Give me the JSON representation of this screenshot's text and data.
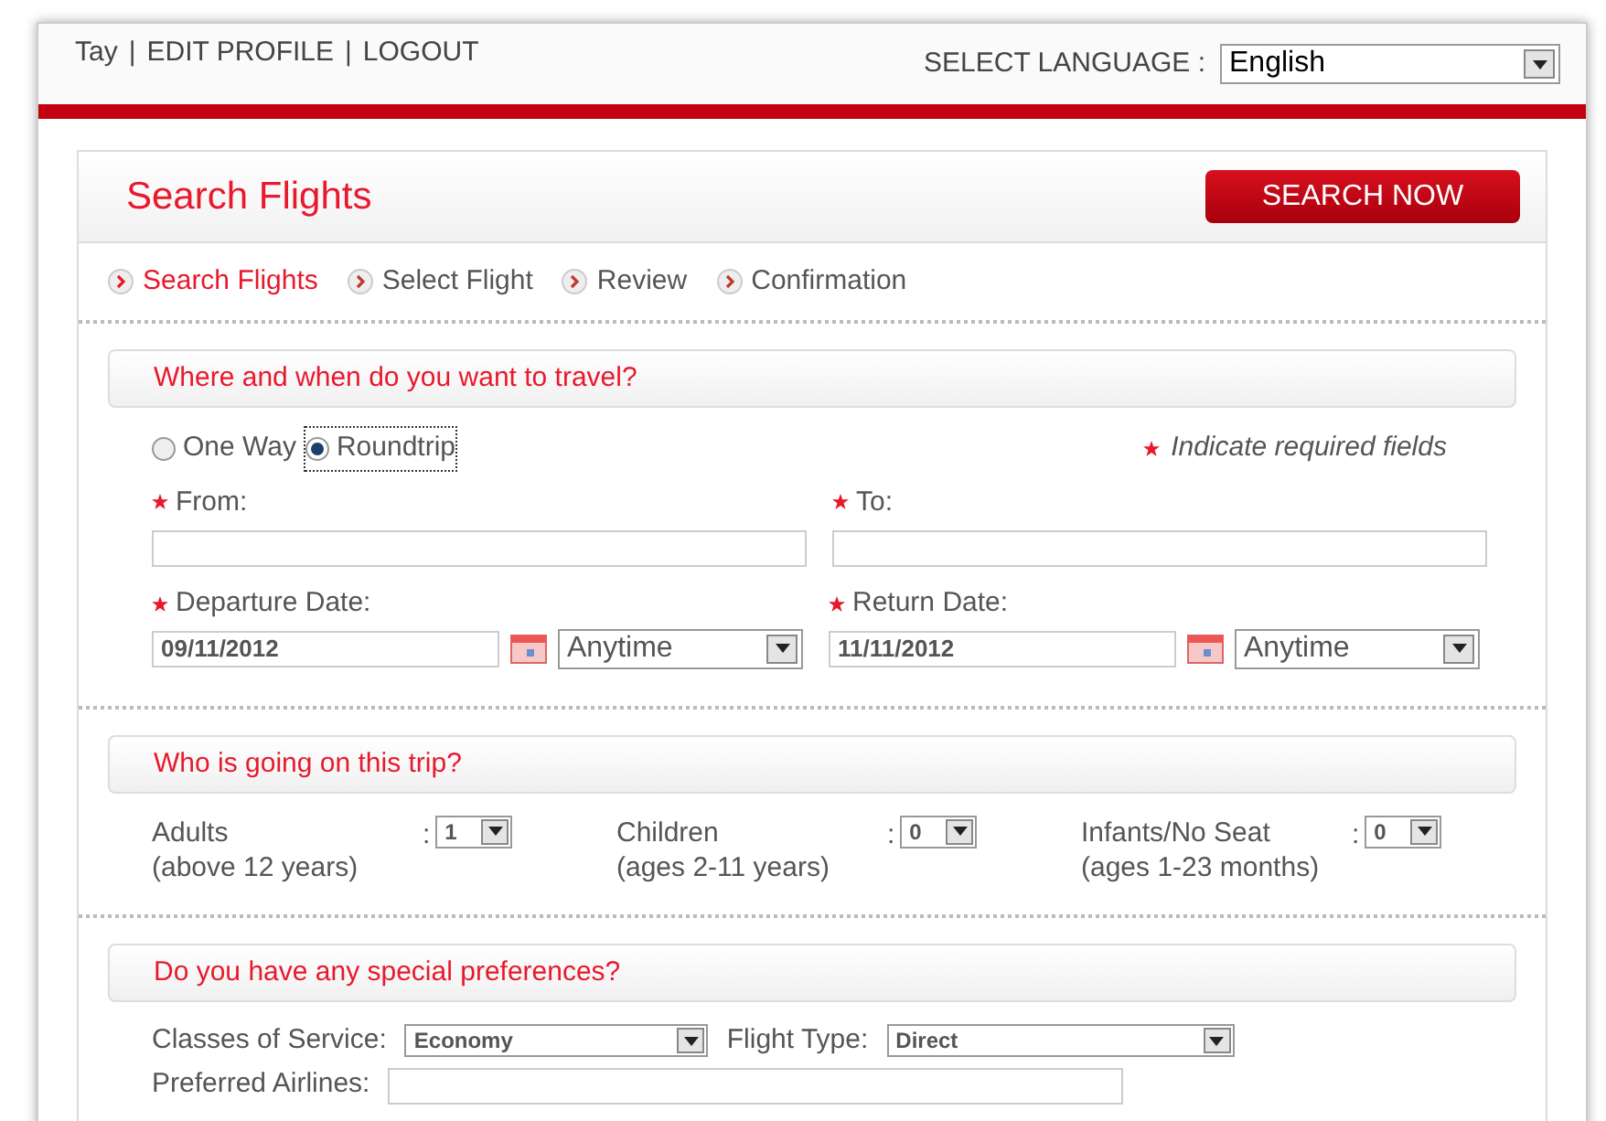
{
  "top_links": [
    "Tay",
    "|",
    "EDIT PROFILE",
    "|",
    "LOGOUT"
  ],
  "language": {
    "label": "SELECT LANGUAGE :",
    "value": "English"
  },
  "panel": {
    "title": "Search Flights",
    "button": "SEARCH NOW"
  },
  "steps": [
    {
      "label": "Search Flights",
      "selected": true
    },
    {
      "label": "Select Flight",
      "selected": false
    },
    {
      "label": "Review",
      "selected": false
    },
    {
      "label": "Confirmation",
      "selected": false
    }
  ],
  "travel": {
    "heading": "Where and when do you want to travel?",
    "trip_types": [
      {
        "label": "One Way",
        "selected": false
      },
      {
        "label": "Roundtrip",
        "selected": true
      }
    ],
    "required_note": "Indicate required fields",
    "from": {
      "label": "From:"
    },
    "to": {
      "label": "To:"
    },
    "departure": {
      "label": "Departure Date:",
      "date": "09/11/2012",
      "time": "Anytime"
    },
    "return": {
      "label": "Return Date:",
      "date": "11/11/2012",
      "time": "Anytime"
    }
  },
  "passengers": {
    "heading": "Who is going on this trip?",
    "groups": [
      {
        "label": "Adults",
        "note": "(above 12 years)",
        "colon": ":",
        "value": "1"
      },
      {
        "label": "Children",
        "note": "(ages 2-11 years)",
        "colon": ":",
        "value": "0"
      },
      {
        "label": "Infants/No Seat",
        "note": "(ages 1-23 months)",
        "colon": ":",
        "value": "0"
      }
    ]
  },
  "preferences": {
    "heading": "Do you have any special preferences?",
    "class_label": "Classes of Service:",
    "class_value": "Economy",
    "type_label": "Flight Type:",
    "type_value": "Direct",
    "airlines_label": "Preferred Airlines:"
  }
}
